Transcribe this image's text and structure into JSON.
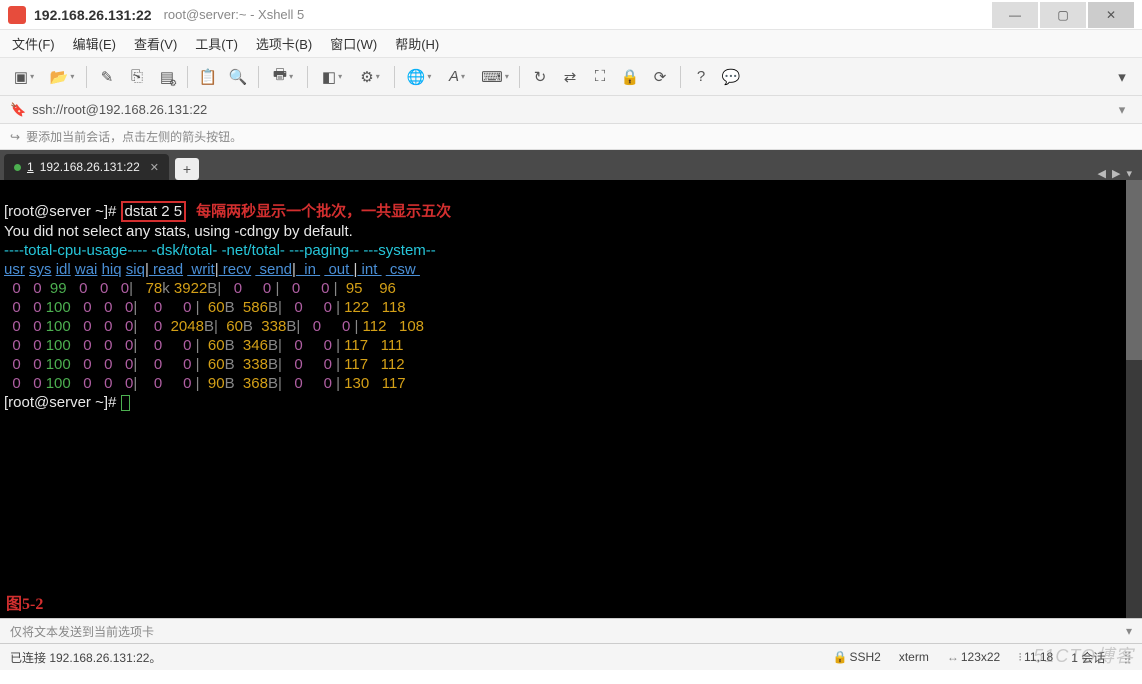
{
  "title": {
    "ip": "192.168.26.131:22",
    "session": "root@server:~ - Xshell 5"
  },
  "menu": [
    "文件(F)",
    "编辑(E)",
    "查看(V)",
    "工具(T)",
    "选项卡(B)",
    "窗口(W)",
    "帮助(H)"
  ],
  "toolbar_icons": [
    "new-session",
    "open",
    "save",
    "properties",
    "copy",
    "paste",
    "search",
    "print",
    "color",
    "encoding",
    "globe",
    "font",
    "keymap",
    "fullscreen",
    "transfer",
    "expand",
    "lock",
    "reconnect",
    "help",
    "tile"
  ],
  "address": {
    "url": "ssh://root@192.168.26.131:22"
  },
  "hint": "要添加当前会话，点击左侧的箭头按钮。",
  "tab": {
    "num": "1",
    "label": "192.168.26.131:22"
  },
  "terminal": {
    "prompt": "[root@server ~]#",
    "command": "dstat 2 5",
    "annotation": "每隔两秒显示一个批次，一共显示五次",
    "msg": "You did not select any stats, using -cdngy by default.",
    "hdr1": {
      "cpu": "----total-cpu-usage----",
      "dsk": "-dsk/total-",
      "net": "-net/total-",
      "pag": "---paging--",
      "sys": "---system--"
    },
    "hdr2": [
      "usr",
      "sys",
      "idl",
      "wai",
      "hiq",
      "siq",
      "read",
      "writ",
      "recv",
      "send",
      "in",
      "out",
      "int",
      "csw"
    ],
    "rows": [
      {
        "usr": "0",
        "sys": "0",
        "idl": "99",
        "wai": "0",
        "hiq": "0",
        "siq": "0",
        "read": "78",
        "readU": "k",
        "writ": "3922",
        "writU": "B",
        "recv": "0",
        "recvU": "",
        "send": "0",
        "sendU": "",
        "in": "0",
        "out": "0",
        "int": "95",
        "csw": "96"
      },
      {
        "usr": "0",
        "sys": "0",
        "idl": "100",
        "wai": "0",
        "hiq": "0",
        "siq": "0",
        "read": "0",
        "readU": "",
        "writ": "0",
        "writU": "",
        "recv": "60",
        "recvU": "B",
        "send": "586",
        "sendU": "B",
        "in": "0",
        "out": "0",
        "int": "122",
        "csw": "118"
      },
      {
        "usr": "0",
        "sys": "0",
        "idl": "100",
        "wai": "0",
        "hiq": "0",
        "siq": "0",
        "read": "0",
        "readU": "",
        "writ": "2048",
        "writU": "B",
        "recv": "60",
        "recvU": "B",
        "send": "338",
        "sendU": "B",
        "in": "0",
        "out": "0",
        "int": "112",
        "csw": "108"
      },
      {
        "usr": "0",
        "sys": "0",
        "idl": "100",
        "wai": "0",
        "hiq": "0",
        "siq": "0",
        "read": "0",
        "readU": "",
        "writ": "0",
        "writU": "",
        "recv": "60",
        "recvU": "B",
        "send": "346",
        "sendU": "B",
        "in": "0",
        "out": "0",
        "int": "117",
        "csw": "111"
      },
      {
        "usr": "0",
        "sys": "0",
        "idl": "100",
        "wai": "0",
        "hiq": "0",
        "siq": "0",
        "read": "0",
        "readU": "",
        "writ": "0",
        "writU": "",
        "recv": "60",
        "recvU": "B",
        "send": "338",
        "sendU": "B",
        "in": "0",
        "out": "0",
        "int": "117",
        "csw": "112"
      },
      {
        "usr": "0",
        "sys": "0",
        "idl": "100",
        "wai": "0",
        "hiq": "0",
        "siq": "0",
        "read": "0",
        "readU": "",
        "writ": "0",
        "writU": "",
        "recv": "90",
        "recvU": "B",
        "send": "368",
        "sendU": "B",
        "in": "0",
        "out": "0",
        "int": "130",
        "csw": "117"
      }
    ],
    "figlabel": "图5-2"
  },
  "tabhint": "仅将文本发送到当前选项卡",
  "status": {
    "conn": "已连接 192.168.26.131:22。",
    "proto": "SSH2",
    "term": "xterm",
    "size": "123x22",
    "cursor": "11,18",
    "sess": "1 会话"
  },
  "watermark": "51CTO博客"
}
